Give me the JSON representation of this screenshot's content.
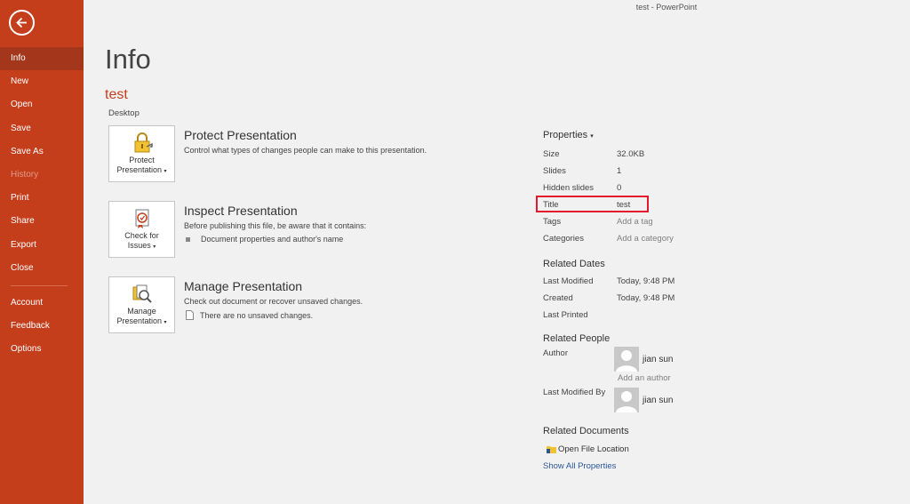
{
  "window": {
    "title": "test  -  PowerPoint"
  },
  "sidebar": {
    "back_icon": "back-arrow-icon",
    "items": [
      {
        "label": "Info",
        "active": true
      },
      {
        "label": "New"
      },
      {
        "label": "Open"
      },
      {
        "label": "Save"
      },
      {
        "label": "Save As"
      },
      {
        "label": "History",
        "disabled": true
      },
      {
        "label": "Print"
      },
      {
        "label": "Share"
      },
      {
        "label": "Export"
      },
      {
        "label": "Close"
      },
      {
        "label": "Account"
      },
      {
        "label": "Feedback"
      },
      {
        "label": "Options"
      }
    ]
  },
  "main": {
    "title": "Info",
    "doc_name": "test",
    "doc_location": "Desktop",
    "actions": [
      {
        "btn_line1": "Protect",
        "btn_line2": "Presentation",
        "heading": "Protect Presentation",
        "desc": "Control what types of changes people can make to this presentation.",
        "icon": "lock-key-icon"
      },
      {
        "btn_line1": "Check for",
        "btn_line2": "Issues",
        "heading": "Inspect Presentation",
        "desc": "Before publishing this file, be aware that it contains:",
        "sub": "Document properties and author's name",
        "icon": "inspect-document-icon"
      },
      {
        "btn_line1": "Manage",
        "btn_line2": "Presentation",
        "heading": "Manage Presentation",
        "desc": "Check out document or recover unsaved changes.",
        "sub": "There are no unsaved changes.",
        "icon": "manage-versions-icon"
      }
    ]
  },
  "properties": {
    "heading": "Properties",
    "rows": [
      {
        "key": "Size",
        "value": "32.0KB"
      },
      {
        "key": "Slides",
        "value": "1"
      },
      {
        "key": "Hidden slides",
        "value": "0"
      },
      {
        "key": "Title",
        "value": "test"
      },
      {
        "key": "Tags",
        "value": "Add a tag"
      },
      {
        "key": "Categories",
        "value": "Add a category"
      }
    ],
    "highlight_color": "#e4192b"
  },
  "related_dates": {
    "heading": "Related Dates",
    "rows": [
      {
        "key": "Last Modified",
        "value": "Today, 9:48 PM"
      },
      {
        "key": "Created",
        "value": "Today, 9:48 PM"
      },
      {
        "key": "Last Printed",
        "value": ""
      }
    ]
  },
  "related_people": {
    "heading": "Related People",
    "author_label": "Author",
    "author_name": "jian sun",
    "add_author": "Add an author",
    "last_modified_by_label": "Last Modified By",
    "last_modified_by_name": "jian sun"
  },
  "related_documents": {
    "heading": "Related Documents",
    "open_location": "Open File Location",
    "show_all": "Show All Properties"
  },
  "colors": {
    "accent": "#c43e1c",
    "link": "#2b579a"
  }
}
